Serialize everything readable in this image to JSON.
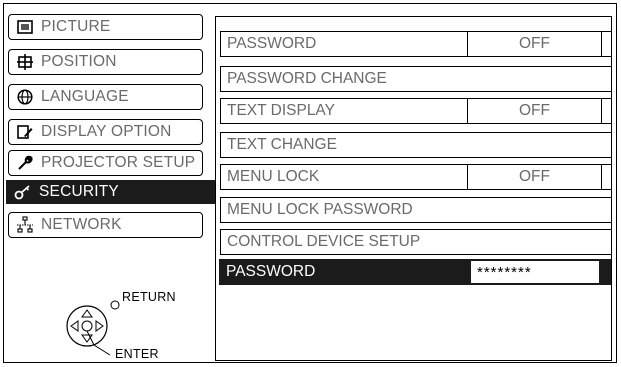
{
  "menu": {
    "tabs": [
      {
        "label": "PICTURE",
        "icon": "picture-icon"
      },
      {
        "label": "POSITION",
        "icon": "position-icon"
      },
      {
        "label": "LANGUAGE",
        "icon": "globe-icon"
      },
      {
        "label": "DISPLAY OPTION",
        "icon": "display-option-icon"
      },
      {
        "label": "PROJECTOR SETUP",
        "icon": "wrench-icon"
      },
      {
        "label": "SECURITY",
        "icon": "key-icon",
        "active": true
      },
      {
        "label": "NETWORK",
        "icon": "network-icon"
      }
    ]
  },
  "security": {
    "rows": [
      {
        "label": "PASSWORD",
        "value": "OFF"
      },
      {
        "label": "PASSWORD CHANGE"
      },
      {
        "label": "TEXT DISPLAY",
        "value": "OFF"
      },
      {
        "label": "TEXT CHANGE"
      },
      {
        "label": "MENU LOCK",
        "value": "OFF"
      },
      {
        "label": "MENU LOCK PASSWORD"
      },
      {
        "label": "CONTROL DEVICE SETUP"
      }
    ],
    "password_prompt": {
      "label": "PASSWORD",
      "value": "********"
    }
  },
  "nav": {
    "return_label": "RETURN",
    "enter_label": "ENTER"
  },
  "colors": {
    "highlight": "#1b1b1b",
    "text": "#6a6a6a",
    "border": "#000000"
  }
}
